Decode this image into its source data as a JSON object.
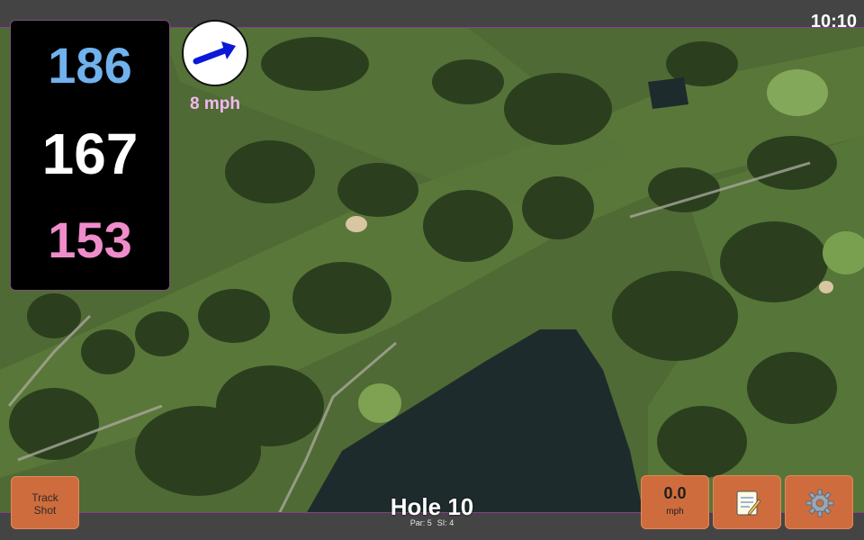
{
  "status_bar": {
    "time": "10:10"
  },
  "distances": {
    "back": "186",
    "middle": "167",
    "front": "153"
  },
  "wind": {
    "speed_label": "8 mph",
    "arrow_icon": "wind-direction-arrow-icon"
  },
  "buttons": {
    "track_shot": {
      "line1": "Track",
      "line2": "Shot"
    },
    "speed": {
      "value": "0.0",
      "unit": "mph"
    },
    "notes": {
      "icon": "notepad-icon"
    },
    "settings": {
      "icon": "gear-icon"
    }
  },
  "hole": {
    "title": "Hole 10",
    "par": "Par: 5",
    "stroke_index": "SI: 4"
  },
  "colors": {
    "back_distance": "#6fb2ee",
    "middle_distance": "#ffffff",
    "front_distance": "#f08ccc",
    "wind_text": "#f4b8f0",
    "button": "#cf6c3d"
  }
}
